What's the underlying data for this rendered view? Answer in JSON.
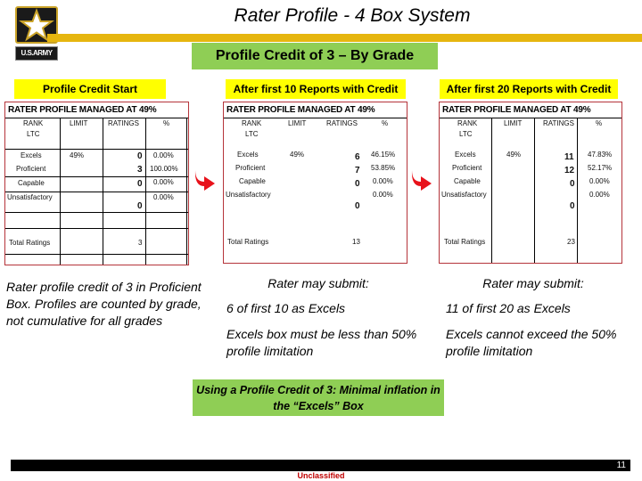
{
  "logo": {
    "label": "U.S.ARMY"
  },
  "title": "Rater Profile - 4 Box System",
  "subtitle": "Profile Credit of 3 – By Grade",
  "colors": {
    "gold": "#e6b60f",
    "green": "#8fce55",
    "yellow": "#ffff00",
    "table_border": "#b5343a",
    "arrow": "#e8121b",
    "classification": "#c00000"
  },
  "panels": [
    {
      "heading": "Profile  Credit Start",
      "table": {
        "title": "RATER PROFILE MANAGED AT 49%",
        "columns": [
          "RANK",
          "LIMIT",
          "RATINGS",
          "%"
        ],
        "rank": "LTC",
        "rows": [
          {
            "label": "Excels",
            "limit": "49%",
            "ratings": "0",
            "pct": "0.00%"
          },
          {
            "label": "Proficient",
            "limit": "",
            "ratings": "3",
            "pct": "100.00%"
          },
          {
            "label": "Capable",
            "limit": "",
            "ratings": "0",
            "pct": "0.00%"
          },
          {
            "label": "Unsatisfactory",
            "limit": "",
            "ratings": "0",
            "pct": "0.00%"
          }
        ],
        "total_label": "Total Ratings",
        "total": "3"
      },
      "note": "Rater profile credit of 3 in Proficient Box.  Profiles are counted by grade, not cumulative for all grades"
    },
    {
      "heading": "After first 10 Reports with Credit",
      "table": {
        "title": "RATER PROFILE MANAGED AT 49%",
        "columns": [
          "RANK",
          "LIMIT",
          "RATINGS",
          "%"
        ],
        "rank": "LTC",
        "rows": [
          {
            "label": "Excels",
            "limit": "49%",
            "ratings": "6",
            "pct": "46.15%"
          },
          {
            "label": "Proficient",
            "limit": "",
            "ratings": "7",
            "pct": "53.85%"
          },
          {
            "label": "Capable",
            "limit": "",
            "ratings": "0",
            "pct": "0.00%"
          },
          {
            "label": "Unsatisfactory",
            "limit": "",
            "ratings": "0",
            "pct": "0.00%"
          }
        ],
        "total_label": "Total Ratings",
        "total": "13"
      },
      "may_submit": "Rater may submit:",
      "note_a": "6 of first 10 as Excels",
      "note_b": "Excels box must be less than 50% profile limitation"
    },
    {
      "heading": "After first 20 Reports with Credit",
      "table": {
        "title": "RATER PROFILE MANAGED AT 49%",
        "columns": [
          "RANK",
          "LIMIT",
          "RATINGS",
          "%"
        ],
        "rank": "LTC",
        "rows": [
          {
            "label": "Excels",
            "limit": "49%",
            "ratings": "11",
            "pct": "47.83%"
          },
          {
            "label": "Proficient",
            "limit": "",
            "ratings": "12",
            "pct": "52.17%"
          },
          {
            "label": "Capable",
            "limit": "",
            "ratings": "0",
            "pct": "0.00%"
          },
          {
            "label": "Unsatisfactory",
            "limit": "",
            "ratings": "0",
            "pct": "0.00%"
          }
        ],
        "total_label": "Total Ratings",
        "total": "23"
      },
      "may_submit": "Rater may submit:",
      "note_a": "11 of first 20 as Excels",
      "note_b": "Excels cannot exceed the 50% profile limitation"
    }
  ],
  "callout": "Using a Profile Credit of 3:  Minimal inflation in the “Excels” Box",
  "footer": {
    "page_number": "11",
    "classification": "Unclassified"
  }
}
